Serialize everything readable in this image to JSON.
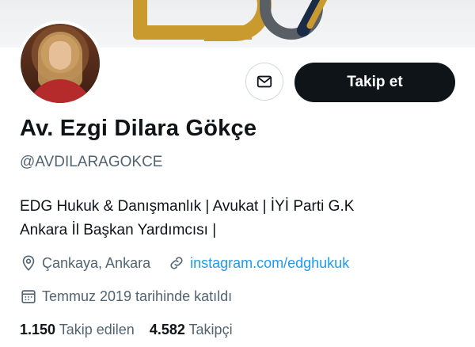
{
  "profile": {
    "display_name": "Av. Ezgi Dilara Gökçe",
    "handle": "@AVDILARAGOKCE",
    "bio_line1": "EDG Hukuk & Danışmanlık | Avukat | İYİ Parti G.K",
    "bio_line2": "Ankara İl Başkan Yardımcısı |",
    "location": "Çankaya, Ankara",
    "website": "instagram.com/edghukuk",
    "joined": "Temmuz 2019 tarihinde katıldı",
    "following_count": "1.150",
    "following_label": "Takip edilen",
    "followers_count": "4.582",
    "followers_label": "Takipçi"
  },
  "actions": {
    "follow_label": "Takip et"
  },
  "icons": {
    "message": "envelope-icon",
    "location": "map-pin-icon",
    "website": "link-icon",
    "joined": "calendar-icon"
  },
  "colors": {
    "follow_bg": "#0f1419",
    "link": "#1d9bf0",
    "muted": "#536471",
    "banner_gold": "#c99a2e"
  }
}
